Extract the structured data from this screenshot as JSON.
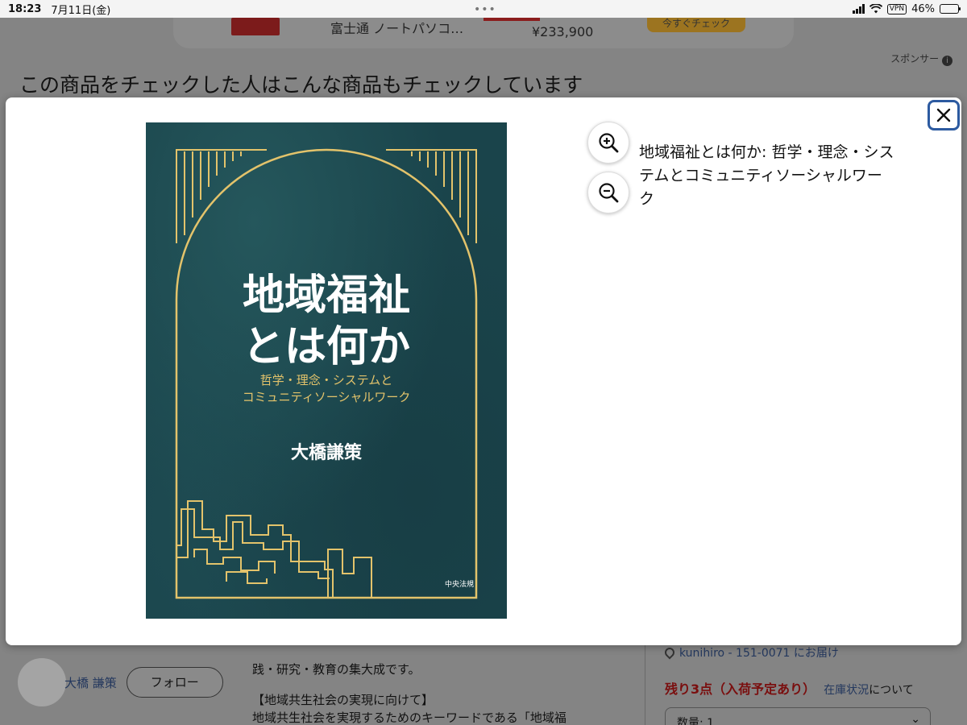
{
  "status_bar": {
    "time": "18:23",
    "date": "7月11日(金)",
    "vpn": "VPN",
    "battery": "46%"
  },
  "background": {
    "ad": {
      "title": "富士通 ノートパソコ…",
      "price": "¥233,900",
      "button": "今すぐチェック"
    },
    "sponsor": "スポンサー",
    "heading": "この商品をチェックした人はこんな商品もチェックしています",
    "seller": {
      "name": "大橋 謙策",
      "follow": "フォロー"
    },
    "description": [
      "践・研究・教育の集大成です。",
      "【地域共生社会の実現に向けて】",
      "地域共生社会を実現するためのキーワードである「地域福"
    ],
    "delivery": "kunihiro - 151-0071 にお届け",
    "stock": {
      "remaining": "残り3点（入荷予定あり）",
      "link": "在庫状況",
      "suffix": "について"
    },
    "quantity": "数量: 1"
  },
  "modal": {
    "product_title": "地域福祉とは何か: 哲学・理念・システムとコミュニティソーシャルワーク",
    "cover": {
      "title_line1": "地域福祉",
      "title_line2": "とは何か",
      "subtitle_line1": "哲学・理念・システムと",
      "subtitle_line2": "コミュニティソーシャルワーク",
      "author": "大橋謙策",
      "publisher": "中央法規"
    }
  },
  "colors": {
    "cover_bg": "#1a444b",
    "cover_gold": "#e3c36b",
    "close_outline": "#2c5aa0"
  }
}
